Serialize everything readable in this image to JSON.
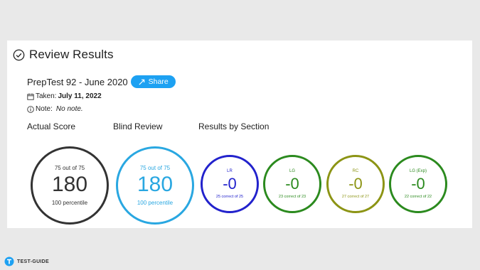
{
  "header": {
    "title": "Review Results",
    "icon": "check-circle-icon"
  },
  "test": {
    "name": "PrepTest 92 - June 2020",
    "share_label": "Share",
    "taken_label": "Taken:",
    "taken_date": "July 11, 2022",
    "note_label": "Note:",
    "note_value": "No note."
  },
  "labels": {
    "actual_score": "Actual Score",
    "blind_review": "Blind Review",
    "results_by_section": "Results by Section"
  },
  "actual": {
    "top": "75 out of 75",
    "score": "180",
    "bottom": "100 percentile",
    "color": "#333333"
  },
  "blind": {
    "top": "75 out of 75",
    "score": "180",
    "bottom": "100 percentile",
    "color": "#29a7e1"
  },
  "sections": [
    {
      "name": "LR",
      "score": "-0",
      "sub": "25 correct of 25",
      "color": "#2222cc"
    },
    {
      "name": "LG",
      "score": "-0",
      "sub": "23 correct of 23",
      "color": "#2b8a1e"
    },
    {
      "name": "RC",
      "score": "-0",
      "sub": "27 correct of 27",
      "color": "#8c9414"
    },
    {
      "name": "LG (Exp)",
      "score": "-0",
      "sub": "22 correct of 22",
      "color": "#2b8a1e"
    }
  ],
  "footer": {
    "brand": "TEST-GUIDE",
    "logo": "test-guide-logo-icon"
  }
}
